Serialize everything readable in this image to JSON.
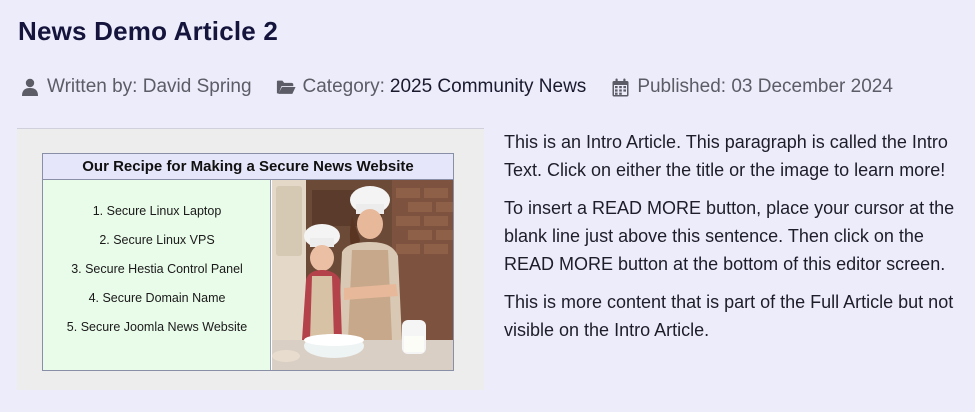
{
  "article": {
    "title": "News Demo Article 2",
    "meta": {
      "written_by_label": "Written by: David Spring",
      "category_label": "Category:",
      "category_value": "2025 Community News",
      "published_label": "Published: 03 December 2024"
    },
    "image": {
      "heading": "Our Recipe for Making a Secure News Website",
      "steps": [
        "1. Secure Linux Laptop",
        "2. Secure Linux VPS",
        "3. Secure Hestia Control Panel",
        "4. Secure Domain Name",
        "5. Secure Joomla News Website"
      ]
    },
    "paragraphs": [
      "This is an Intro Article. This paragraph is called the Intro Text. Click on either the title or the image to learn more!",
      "To insert a READ MORE button, place your cursor at the blank line just above this sentence. Then click on the READ MORE button at the bottom of this editor screen.",
      "This is more content that is part of the Full Article but not visible on the Intro Article."
    ]
  },
  "icons": {
    "author": "user-icon",
    "category": "folder-open-icon",
    "published": "calendar-icon"
  },
  "colors": {
    "background": "#ececfb",
    "title": "#14143c",
    "meta_text": "#5c5c66",
    "recipe_header_bg": "#e6e6fb",
    "recipe_list_bg": "#e9fbe9"
  }
}
